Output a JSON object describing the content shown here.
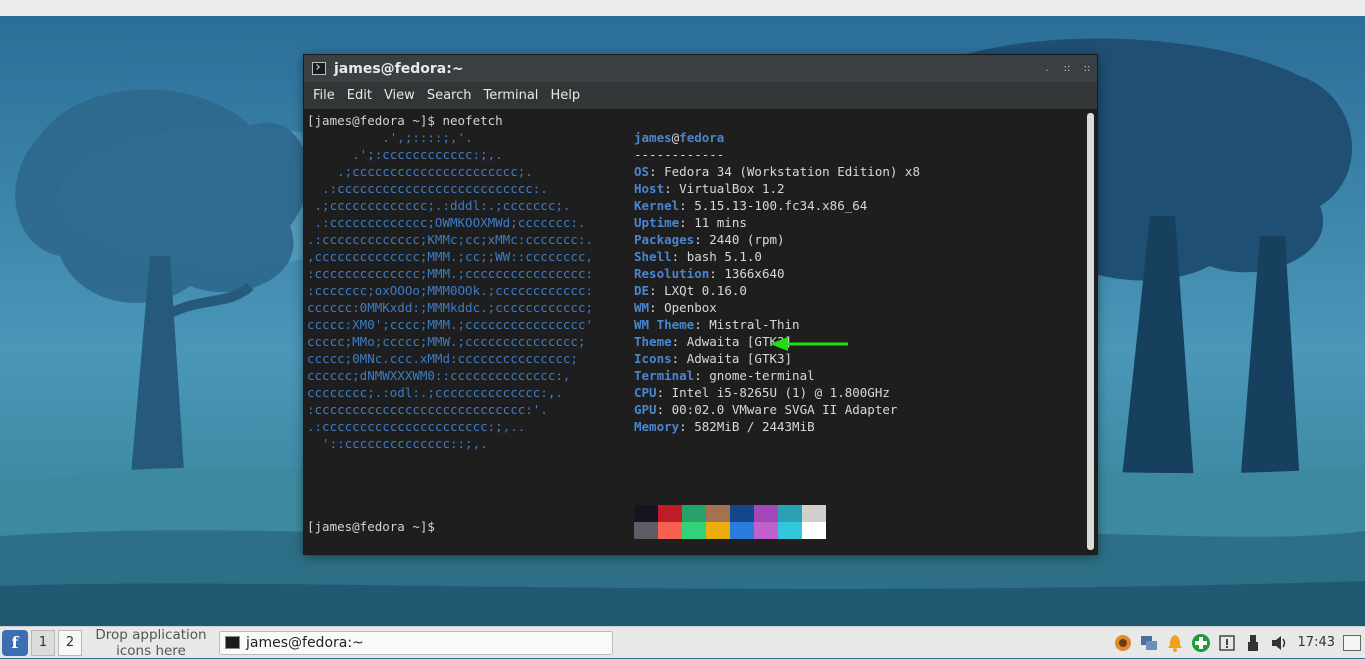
{
  "terminal": {
    "title": "james@fedora:~",
    "window_buttons": [
      ".",
      "::",
      "::"
    ],
    "menu": [
      "File",
      "Edit",
      "View",
      "Search",
      "Terminal",
      "Help"
    ],
    "command_line": "[james@fedora ~]$ neofetch",
    "prompt_line": "[james@fedora ~]$ ",
    "logo_lines": [
      "          .',;::::;,'.",
      "      .';:cccccccccccc:;,.",
      "    .;cccccccccccccccccccccc;.",
      "  .:cccccccccccccccccccccccccc:.",
      " .;ccccccccccccc;.:dddl:.;ccccccc;.",
      " .:ccccccccccccc;OWMKOOXMWd;ccccccc:.",
      ".:ccccccccccccc;KMMc;cc;xMMc:ccccccc:.",
      ",cccccccccccccc;MMM.;cc;;WW::cccccccc,",
      ":cccccccccccccc;MMM.;cccccccccccccccc:",
      ":ccccccc;oxOOOo;MMM0OOk.;cccccccccccc:",
      "cccccc:0MMKxdd:;MMMkddc.;cccccccccccc;",
      "ccccc:XM0';cccc;MMM.;cccccccccccccccc'",
      "ccccc;MMo;ccccc;MMW.;ccccccccccccccc;",
      "ccccc;0MNc.ccc.xMMd:ccccccccccccccc;",
      "cccccc;dNMWXXXWM0::cccccccccccccc:,",
      "cccccccc;.:odl:.;cccccccccccccc:,.",
      ":cccccccccccccccccccccccccccc:'.",
      ".:cccccccccccccccccccccc:;,..",
      "  '::cccccccccccccc::;,."
    ],
    "info": {
      "user": "james",
      "at": "@",
      "host": "fedora",
      "separator": "------------",
      "rows": [
        {
          "key": "OS",
          "value": ": Fedora 34 (Workstation Edition) x8"
        },
        {
          "key": "Host",
          "value": ": VirtualBox 1.2"
        },
        {
          "key": "Kernel",
          "value": ": 5.15.13-100.fc34.x86_64"
        },
        {
          "key": "Uptime",
          "value": ": 11 mins"
        },
        {
          "key": "Packages",
          "value": ": 2440 (rpm)"
        },
        {
          "key": "Shell",
          "value": ": bash 5.1.0"
        },
        {
          "key": "Resolution",
          "value": ": 1366x640"
        },
        {
          "key": "DE",
          "value": ": LXQt 0.16.0"
        },
        {
          "key": "WM",
          "value": ": Openbox"
        },
        {
          "key": "WM Theme",
          "value": ": Mistral-Thin"
        },
        {
          "key": "Theme",
          "value": ": Adwaita [GTK3]"
        },
        {
          "key": "Icons",
          "value": ": Adwaita [GTK3]"
        },
        {
          "key": "Terminal",
          "value": ": gnome-terminal"
        },
        {
          "key": "CPU",
          "value": ": Intel i5-8265U (1) @ 1.800GHz"
        },
        {
          "key": "GPU",
          "value": ": 00:02.0 VMware SVGA II Adapter"
        },
        {
          "key": "Memory",
          "value": ": 582MiB / 2443MiB"
        }
      ]
    },
    "palette_top": [
      "#171421",
      "#c01c28",
      "#26a269",
      "#a2734c",
      "#12488b",
      "#a347ba",
      "#2aa1b3",
      "#d0cfcc"
    ],
    "palette_bottom": [
      "#5e5c64",
      "#f66151",
      "#33d17a",
      "#e9ad0c",
      "#2a7bde",
      "#c061cb",
      "#33c7de",
      "#ffffff"
    ],
    "annotation_arrow_color": "#22dd11"
  },
  "taskbar": {
    "workspaces": [
      "1",
      "2"
    ],
    "quicklaunch_text": "Drop application icons here",
    "task_title": "james@fedora:~",
    "tray_icons": [
      "weather-icon",
      "network-icon",
      "notification-bell-icon",
      "update-icon",
      "info-icon",
      "usb-icon",
      "volume-icon"
    ],
    "clock": "17:43"
  }
}
